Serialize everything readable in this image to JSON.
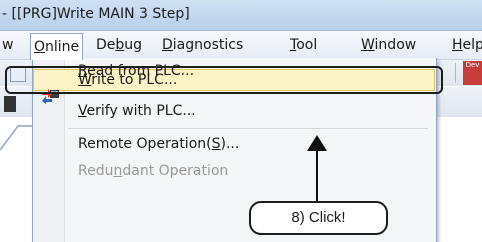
{
  "window": {
    "title": "- [[PRG]Write MAIN 3 Step]"
  },
  "menubar": {
    "items": [
      {
        "label": "w"
      },
      {
        "label": "Online",
        "accel": "O",
        "rest": "nline"
      },
      {
        "label": "Debug",
        "pre": "De",
        "accel": "b",
        "rest": "ug"
      },
      {
        "label": "Diagnostics",
        "accel": "D",
        "rest": "iagnostics"
      },
      {
        "label": "Tool",
        "accel": "T",
        "rest": "ool"
      },
      {
        "label": "Window",
        "accel": "W",
        "rest": "indow"
      },
      {
        "label": "Help",
        "accel": "H",
        "rest": "elp"
      }
    ]
  },
  "online_menu": {
    "items": [
      {
        "label": "Read from PLC...",
        "accel": "R",
        "rest": "ead from PLC...",
        "icon": "read-from-plc-icon"
      },
      {
        "label": "Write to PLC...",
        "accel": "W",
        "rest": "rite to PLC...",
        "icon": "write-to-plc-icon",
        "highlighted": true
      },
      {
        "label": "Verify with PLC...",
        "accel": "V",
        "rest": "erify with PLC..."
      },
      {
        "label": "Remote Operation(S)...",
        "pre": "Remote Operation(",
        "accel": "S",
        "rest": ")..."
      },
      {
        "label": "Redundant Operation",
        "pre": "Redu",
        "accel": "n",
        "rest": "dant Operation",
        "disabled": true
      }
    ]
  },
  "annotation": {
    "callout": "8) Click!"
  },
  "toolbar": {
    "dev_label": "Dev"
  },
  "colors": {
    "highlight_fill": "#fbf3c5",
    "highlight_border": "#e5c365",
    "titlebar": "#cfe0f3"
  }
}
